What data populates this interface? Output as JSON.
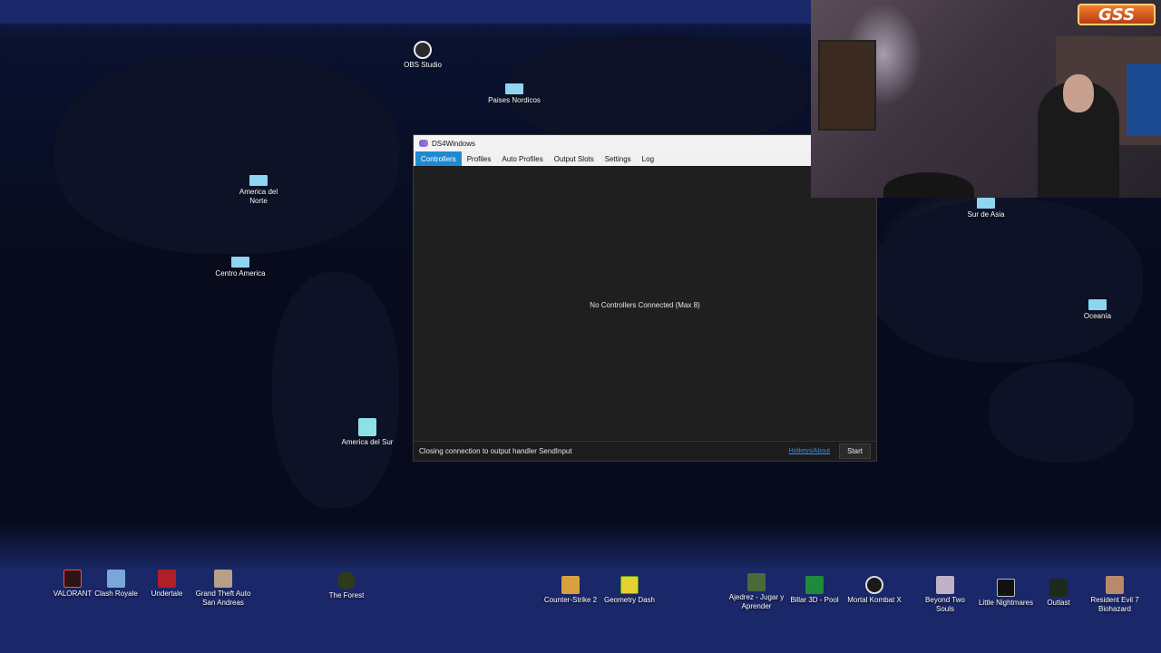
{
  "desktop": {
    "icons": [
      {
        "id": "obs",
        "label": "OBS Studio"
      },
      {
        "id": "paises",
        "label": "Paises Nordicos"
      },
      {
        "id": "america-norte",
        "label": "America del Norte"
      },
      {
        "id": "centro",
        "label": "Centro America"
      },
      {
        "id": "america-sur",
        "label": "America del Sur"
      },
      {
        "id": "sur-asia",
        "label": "Sur de Asia"
      },
      {
        "id": "oceania",
        "label": "Oceanía"
      },
      {
        "id": "valorant",
        "label": "VALORANT"
      },
      {
        "id": "clash",
        "label": "Clash Royale"
      },
      {
        "id": "undertale",
        "label": "Undertale"
      },
      {
        "id": "gta",
        "label": "Grand Theft Auto San Andreas"
      },
      {
        "id": "forest",
        "label": "The Forest"
      },
      {
        "id": "cs2",
        "label": "Counter-Strike 2"
      },
      {
        "id": "gd",
        "label": "Geometry Dash"
      },
      {
        "id": "ajedrez",
        "label": "Ajedrez - Jugar y Aprender"
      },
      {
        "id": "billar",
        "label": "Billar 3D - Pool"
      },
      {
        "id": "mk",
        "label": "Mortal Kombat X"
      },
      {
        "id": "beyond",
        "label": "Beyond Two Souls"
      },
      {
        "id": "little",
        "label": "Little Nightmares"
      },
      {
        "id": "outlast",
        "label": "Outlast"
      },
      {
        "id": "re7",
        "label": "Resident Evil 7 Biohazard"
      }
    ]
  },
  "ds4": {
    "title": "DS4Windows",
    "tabs": [
      "Controllers",
      "Profiles",
      "Auto Profiles",
      "Output Slots",
      "Settings",
      "Log"
    ],
    "active_tab": "Controllers",
    "empty_message": "No Controllers Connected (Max 8)",
    "status": "Closing connection to output handler SendInput",
    "hotkeys_link": "Hotkeys/About",
    "start_label": "Start"
  },
  "webcam": {
    "logo_text": "GSS"
  }
}
